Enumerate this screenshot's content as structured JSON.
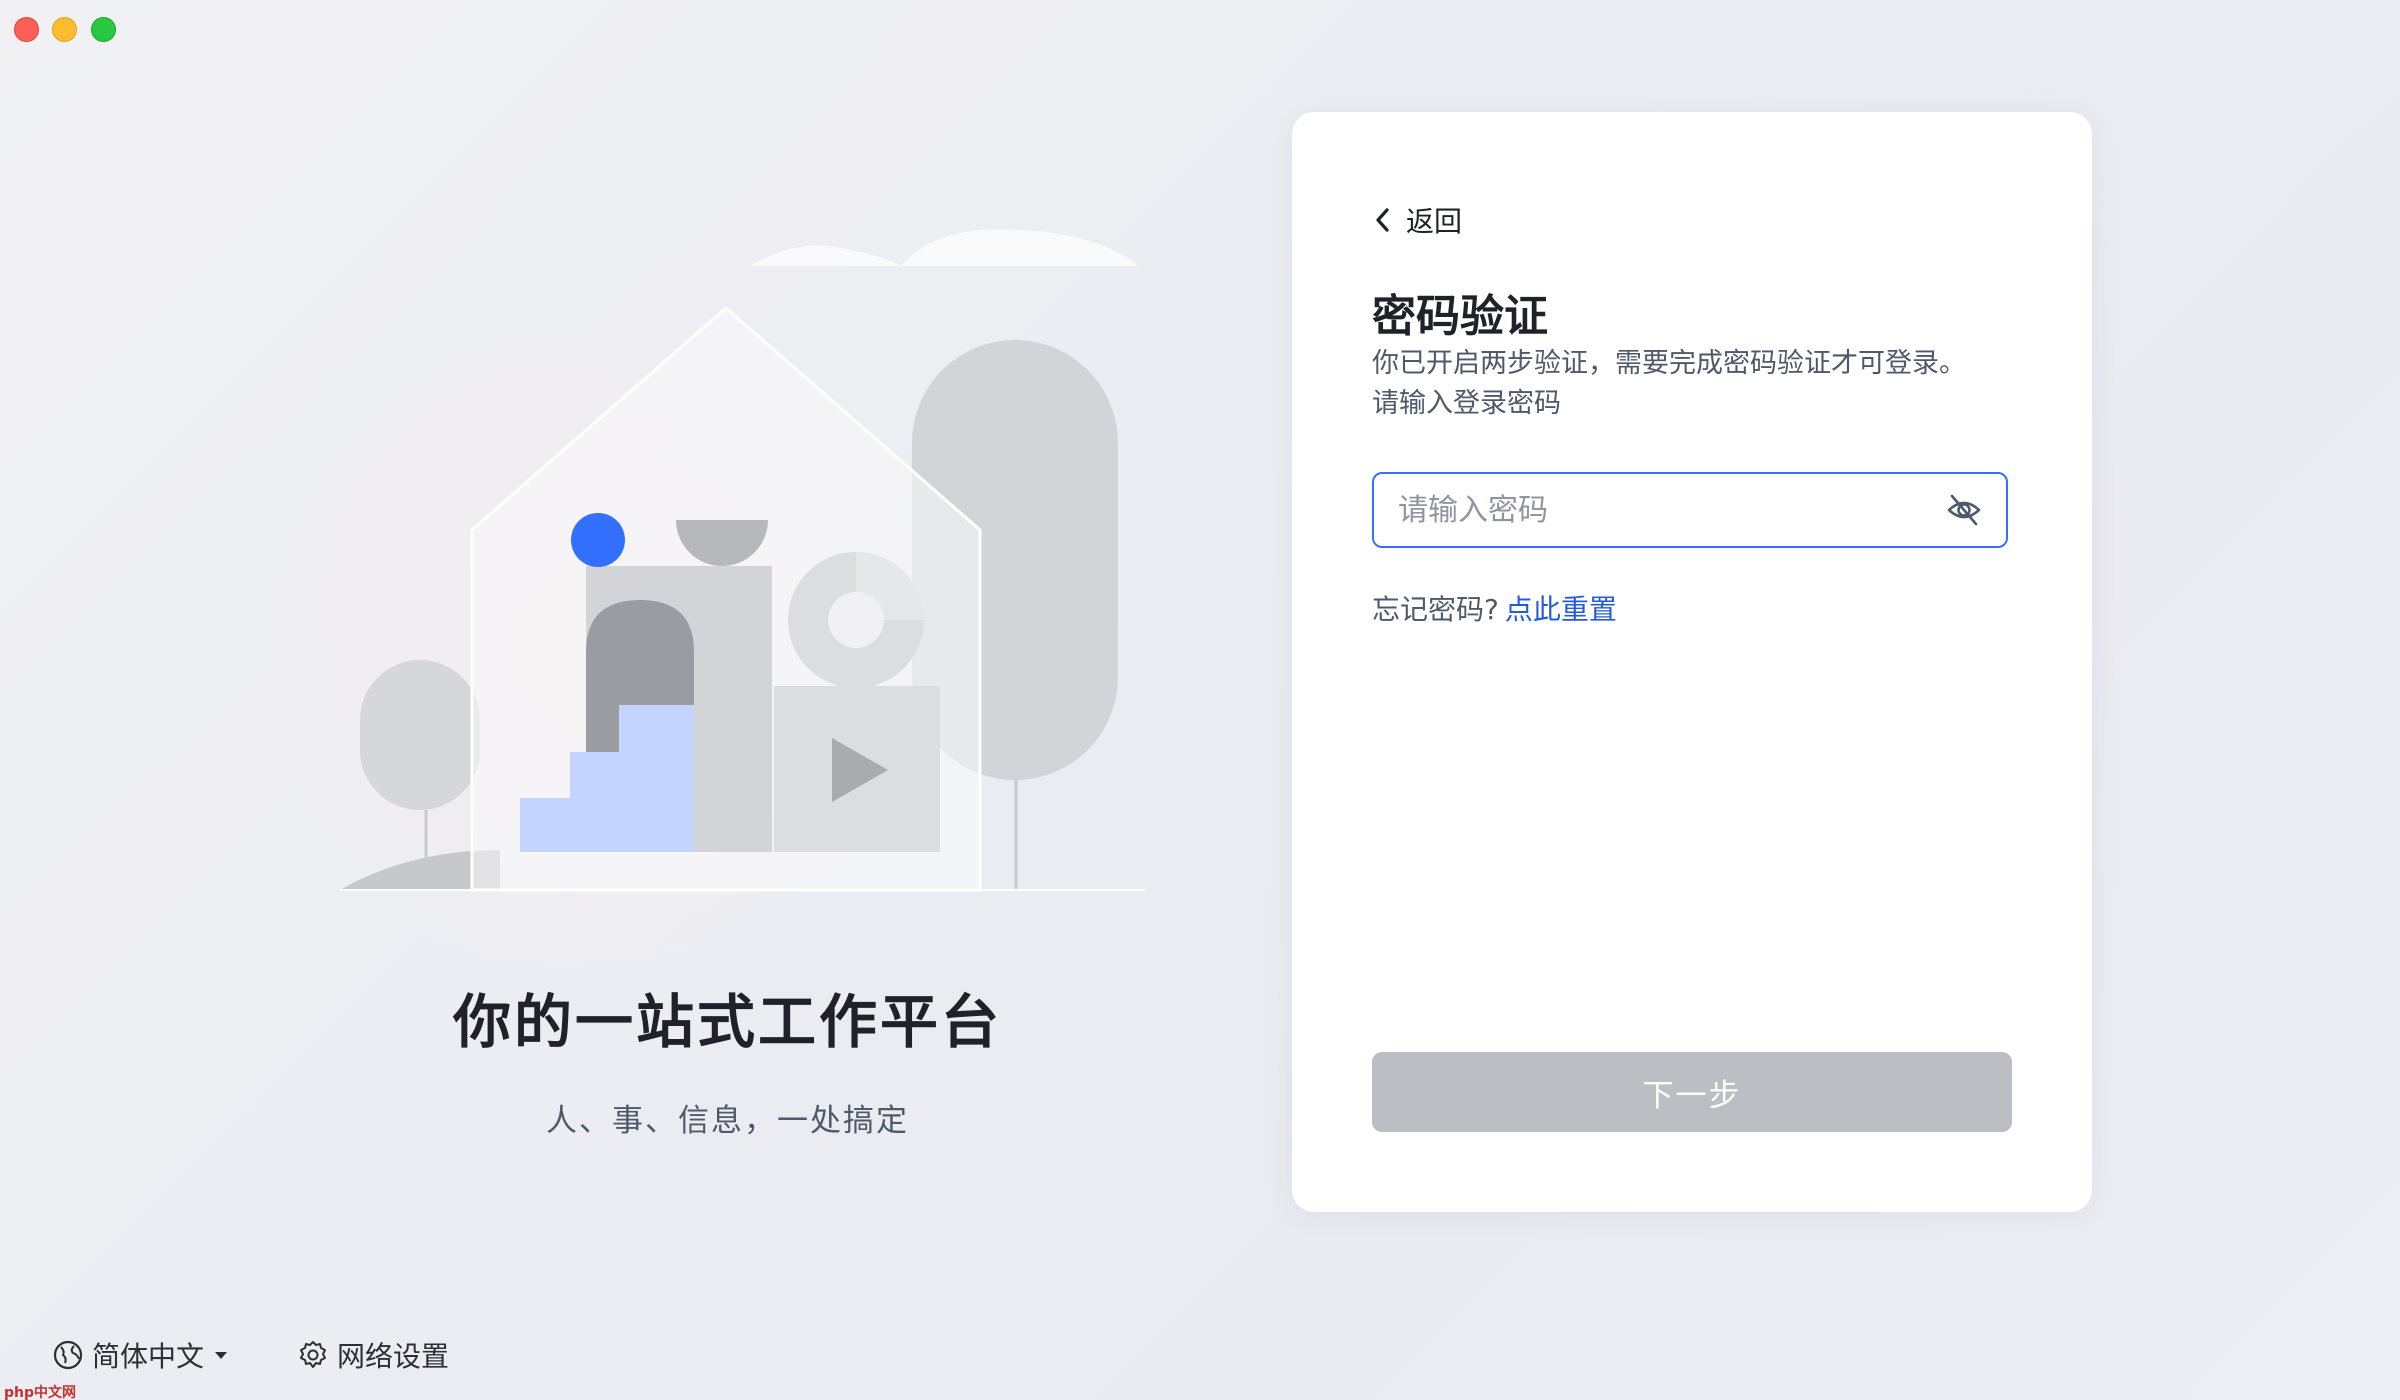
{
  "window": {
    "controls": [
      "close",
      "minimize",
      "maximize"
    ]
  },
  "left": {
    "slogan_title": "你的一站式工作平台",
    "slogan_subtitle": "人、事、信息，一处搞定"
  },
  "footer": {
    "language": "简体中文",
    "network_settings": "网络设置"
  },
  "card": {
    "back_label": "返回",
    "title": "密码验证",
    "description_line1": "你已开启两步验证，需要完成密码验证才可登录。",
    "description_line2": "请输入登录密码",
    "password": {
      "value": "",
      "placeholder": "请输入密码"
    },
    "forgot_prefix": "忘记密码?",
    "reset_link": "点此重置",
    "next_button": "下一步"
  },
  "watermark": "php中文网",
  "colors": {
    "accent": "#3370ff",
    "link": "#245bdb",
    "button_disabled": "#bbbfc4",
    "illustration_blue": "#3370ff",
    "illustration_light_blue": "#c2d4ff"
  },
  "icons": {
    "language": "globe-icon",
    "network": "gear-icon",
    "back": "chevron-left-icon",
    "password_toggle": "eye-off-icon",
    "dropdown": "caret-down-icon"
  }
}
